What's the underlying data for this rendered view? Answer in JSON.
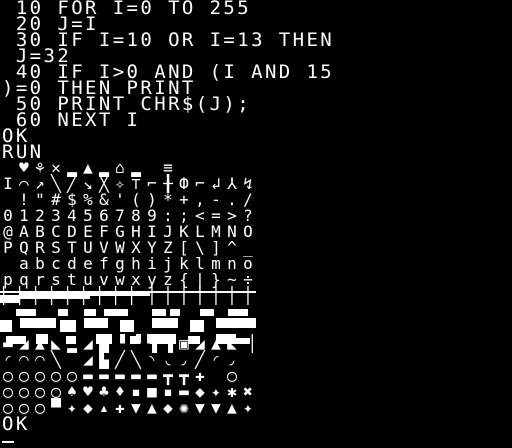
{
  "screen": {
    "background": "#000000",
    "foreground": "#ffffff",
    "program_lines": [
      " 10 FOR I=0 TO 255",
      " 20 J=I",
      " 30 IF I=10 OR I=13 THEN",
      " J=32",
      " 40 IF I>0 AND (I AND 15",
      ")=0 THEN PRINT",
      " 50 PRINT CHR$(J);",
      " 60 NEXT I"
    ],
    "ready_prompt": "OK",
    "run_command": "RUN",
    "charset_rows": [
      "",
      "",
      " !\"#$%&'()*+,-./",
      "0123456789:;<=>?",
      "@ABCDEFGHIJKLMNO",
      "PQRSTUVWXYZ[\\]^_",
      " abcdefghijklmno",
      "pqrstuvwxyz{|}~÷",
      "",
      "",
      "",
      "",
      "",
      "",
      "",
      ""
    ],
    "graphic_rows": [
      [
        "",
        "♥",
        "⚘",
        "✕",
        "▂",
        "▲",
        "▂",
        "⌂",
        "▂",
        "",
        "≡",
        "",
        "",
        "",
        "",
        ""
      ],
      [
        "I",
        "⌒",
        "↗",
        "╲",
        "╱",
        "↘",
        "╳",
        "✧",
        "⊤",
        "⌐",
        "╂",
        "Ф",
        "⌐",
        "↲",
        "⅄",
        "↯"
      ],
      [],
      [],
      [],
      [],
      [],
      [],
      [
        "▏",
        "▏",
        "▏",
        "▏",
        "▏",
        "▏",
        "▏",
        "▏",
        "▏",
        "│",
        "│",
        "│",
        "│",
        "│",
        "│",
        "│"
      ],
      [],
      [],
      [
        "▬",
        "◢",
        "▲",
        "◣",
        "▂",
        "◢",
        "▙",
        "▝",
        "▝",
        "▚",
        "▚",
        "▣",
        "◢",
        "▲",
        "◣",
        "▕"
      ],
      [
        "◜",
        "◠",
        "◠",
        "╲",
        "",
        "◢",
        "▙",
        "╱",
        "╲",
        "◝",
        "◟",
        "◞",
        "╱",
        "◜",
        "◞",
        ""
      ],
      [
        "◯",
        "◯",
        "◯",
        "◯",
        "◯",
        "▬",
        "▬",
        "▬",
        "▬",
        "▬",
        "┳",
        "┳",
        "✚",
        "",
        "◯",
        ""
      ],
      [
        "◯",
        "◯",
        "◯",
        "◯",
        "♠",
        "♥",
        "♣",
        "♦",
        "▪",
        "■",
        "▪",
        "▬",
        "◆",
        "✦",
        "✱",
        "✖"
      ],
      [
        "◯",
        "◯",
        "◯",
        "▀",
        "✦",
        "◆",
        "▴",
        "✚",
        "▼",
        "▲",
        "◆",
        "✺",
        "▼",
        "▼",
        "▲",
        "✦"
      ]
    ],
    "final_prompt": "OK"
  }
}
